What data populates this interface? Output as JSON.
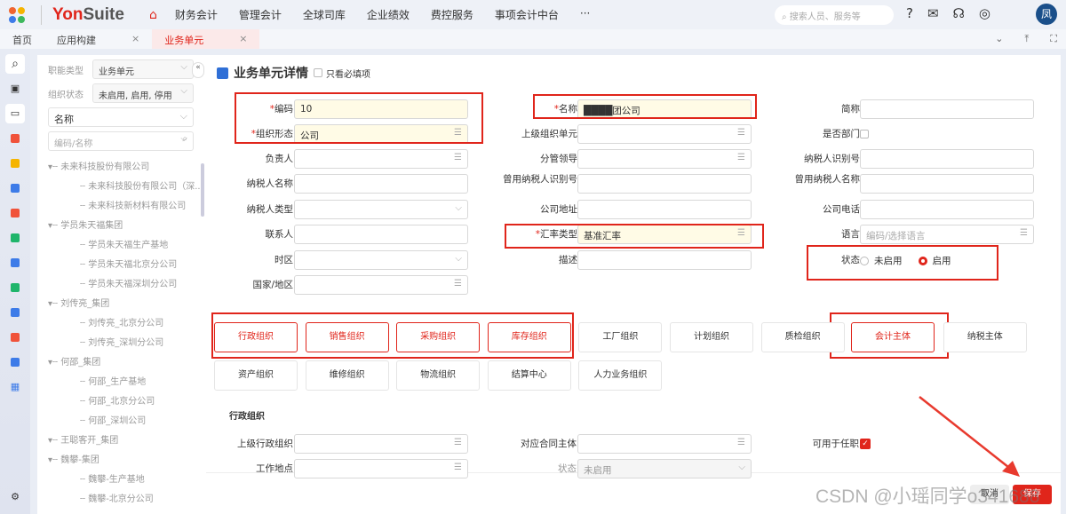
{
  "app": {
    "brand_a": "Yon",
    "brand_b": "Suite",
    "nav": [
      "财务会计",
      "管理会计",
      "全球司库",
      "企业绩效",
      "费控服务",
      "事项会计中台",
      "···"
    ],
    "search_placeholder": "搜索人员、服务等",
    "avatar": "凤"
  },
  "tabs": [
    {
      "label": "首页"
    },
    {
      "label": "应用构建",
      "close": "×"
    },
    {
      "label": "业务单元",
      "close": "×"
    }
  ],
  "tree_panel": {
    "func_type_label": "职能类型",
    "func_type_value": "业务单元",
    "status_label": "组织状态",
    "status_value": "未启用, 启用, 停用",
    "field_select": "名称",
    "search_placeholder": "编码/名称",
    "nodes": [
      {
        "t": "未来科技股份有限公司",
        "l": 0
      },
      {
        "t": "未来科技股份有限公司（深...",
        "l": 1
      },
      {
        "t": "未来科技新材料有限公司",
        "l": 1
      },
      {
        "t": "学员朱天福集团",
        "l": 0
      },
      {
        "t": "学员朱天福生产基地",
        "l": 1
      },
      {
        "t": "学员朱天福北京分公司",
        "l": 1
      },
      {
        "t": "学员朱天福深圳分公司",
        "l": 1
      },
      {
        "t": "刘传亮_集团",
        "l": 0
      },
      {
        "t": "刘传亮_北京分公司",
        "l": 1
      },
      {
        "t": "刘传亮_深圳分公司",
        "l": 1
      },
      {
        "t": "何邵_集团",
        "l": 0
      },
      {
        "t": "何邵_生产基地",
        "l": 1
      },
      {
        "t": "何邵_北京分公司",
        "l": 1
      },
      {
        "t": "何邵_深圳公司",
        "l": 1
      },
      {
        "t": "王聪客开_集团",
        "l": 0
      },
      {
        "t": "魏攀-集团",
        "l": 0
      },
      {
        "t": "魏攀-生产基地",
        "l": 1
      },
      {
        "t": "魏攀-北京分公司",
        "l": 1
      }
    ]
  },
  "main": {
    "title": "业务单元详情",
    "required_only": "只看必填项",
    "rows": [
      [
        {
          "label": "编码",
          "req": true,
          "value": "10",
          "yellow": true
        },
        {
          "label": "名称",
          "req": true,
          "value": "████团公司",
          "yellow": true
        },
        {
          "label": "简称",
          "value": ""
        }
      ],
      [
        {
          "label": "组织形态",
          "req": true,
          "value": "公司",
          "yellow": true,
          "list": true
        },
        {
          "label": "上级组织单元",
          "value": "",
          "list": true
        },
        {
          "label": "是否部门",
          "check": true
        }
      ],
      [
        {
          "label": "负责人",
          "list": true
        },
        {
          "label": "分管领导",
          "list": true
        },
        {
          "label": "纳税人识别号"
        }
      ],
      [
        {
          "label": "纳税人名称"
        },
        {
          "label": "曾用纳税人识别号"
        },
        {
          "label": "曾用纳税人名称"
        }
      ],
      [
        {
          "label": "纳税人类型",
          "drop": true
        },
        {
          "label": "公司地址"
        },
        {
          "label": "公司电话"
        }
      ],
      [
        {
          "label": "联系人"
        },
        {
          "label": "汇率类型",
          "req": true,
          "value": "基准汇率",
          "yellow": true,
          "list": true
        },
        {
          "label": "语言",
          "placeholder": "编码/选择语言",
          "list": true
        }
      ],
      [
        {
          "label": "时区",
          "drop": true
        },
        {
          "label": "描述"
        },
        {
          "label": "状态",
          "radio": true
        }
      ],
      [
        {
          "label": "国家/地区",
          "list": true
        }
      ]
    ],
    "status_options": [
      "未启用",
      "启用"
    ],
    "org_buttons": [
      [
        "行政组织",
        "销售组织",
        "采购组织",
        "库存组织",
        "工厂组织",
        "计划组织",
        "质检组织",
        "会计主体",
        "纳税主体"
      ],
      [
        "资产组织",
        "维修组织",
        "物流组织",
        "结算中心",
        "人力业务组织"
      ]
    ],
    "section_title": "行政组织",
    "section_fields": [
      {
        "label": "上级行政组织"
      },
      {
        "label": "对应合同主体"
      },
      {
        "label": "可用于任职"
      },
      {
        "label": "工作地点"
      },
      {
        "label": "状态",
        "value": "未启用"
      }
    ],
    "cancel": "取消",
    "save": "保存"
  },
  "watermark": "CSDN @小瑶同学o341688"
}
